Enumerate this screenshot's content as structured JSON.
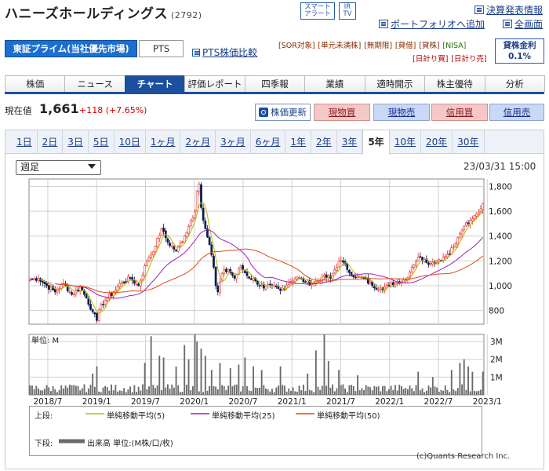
{
  "header": {
    "title": "ハニーズホールディングス",
    "code": "(2792)",
    "smart_alert": [
      "スマート",
      "アラート"
    ],
    "ir_tv": [
      "IR",
      "TV"
    ],
    "portfolio_link": "ポートフォリオへ追加",
    "kessan_link": "決算発表情報",
    "zenshi_link": "全画面",
    "pts_link": "PTS株価比較"
  },
  "market_tabs": [
    "東証プライム(当社優先市場)",
    "PTS"
  ],
  "tags_row1": [
    "[SOR対象]",
    "[単元未満株]",
    "[無期限]",
    "[貸借]",
    "[貸株]",
    "[NISA]"
  ],
  "tags_row2": [
    "[日計り買]",
    "[日計り売]"
  ],
  "rate": {
    "label": "貸株金利",
    "value": "0.1%"
  },
  "nav": [
    "株価",
    "ニュース",
    "チャート",
    "評価レポート",
    "四季報",
    "業績",
    "適時開示",
    "株主優待",
    "分析"
  ],
  "nav_active": 2,
  "price": {
    "label": "現在値",
    "value": "1,661",
    "change": "+118 (+7.65%)"
  },
  "buttons": {
    "update": "株価更新",
    "spot_buy": "現物買",
    "spot_sell": "現物売",
    "margin_buy": "信用買",
    "margin_sell": "信用売"
  },
  "periods": [
    "1日",
    "2日",
    "3日",
    "5日",
    "10日",
    "1ヶ月",
    "2ヶ月",
    "3ヶ月",
    "6ヶ月",
    "1年",
    "2年",
    "3年",
    "5年",
    "10年",
    "20年",
    "30年"
  ],
  "period_active": 12,
  "period_select": "週足",
  "timestamp": "23/03/31 15:00",
  "colors": {
    "up": "#e8302a",
    "down": "#0a1a50",
    "ma5": "#bdb500",
    "ma25": "#a020c0",
    "ma50": "#e04a10",
    "volume": "#6a6a6a",
    "grid": "#d0d0d0"
  },
  "chart_data": {
    "type": "candlestick",
    "x_tick_labels": [
      "2018/7",
      "2019/1",
      "2019/7",
      "2020/1",
      "2020/7",
      "2021/1",
      "2021/7",
      "2022/1",
      "2022/7",
      "2023/1"
    ],
    "price_axis": {
      "ticks": [
        800,
        1000,
        1200,
        1400,
        1600,
        1800
      ],
      "ylim": [
        690,
        1860
      ]
    },
    "price_anchors": [
      [
        0,
        1050
      ],
      [
        4,
        1060
      ],
      [
        8,
        1000
      ],
      [
        12,
        950
      ],
      [
        16,
        1020
      ],
      [
        20,
        930
      ],
      [
        24,
        990
      ],
      [
        27,
        900
      ],
      [
        30,
        790
      ],
      [
        32,
        720
      ],
      [
        34,
        850
      ],
      [
        37,
        900
      ],
      [
        40,
        950
      ],
      [
        44,
        1030
      ],
      [
        48,
        1060
      ],
      [
        52,
        1000
      ],
      [
        56,
        1200
      ],
      [
        60,
        1320
      ],
      [
        63,
        1460
      ],
      [
        66,
        1350
      ],
      [
        70,
        1280
      ],
      [
        74,
        1400
      ],
      [
        77,
        1520
      ],
      [
        79,
        1600
      ],
      [
        80,
        1760
      ],
      [
        81,
        1820
      ],
      [
        82,
        1630
      ],
      [
        84,
        1460
      ],
      [
        86,
        1330
      ],
      [
        88,
        1150
      ],
      [
        89,
        1000
      ],
      [
        90,
        950
      ],
      [
        92,
        1100
      ],
      [
        95,
        1130
      ],
      [
        98,
        1060
      ],
      [
        101,
        1160
      ],
      [
        104,
        1080
      ],
      [
        108,
        1040
      ],
      [
        112,
        980
      ],
      [
        116,
        1000
      ],
      [
        120,
        960
      ],
      [
        124,
        1030
      ],
      [
        128,
        1070
      ],
      [
        132,
        1030
      ],
      [
        136,
        1020
      ],
      [
        140,
        1070
      ],
      [
        144,
        1060
      ],
      [
        148,
        1200
      ],
      [
        150,
        1190
      ],
      [
        152,
        1130
      ],
      [
        156,
        1070
      ],
      [
        160,
        1060
      ],
      [
        164,
        1000
      ],
      [
        168,
        980
      ],
      [
        172,
        1000
      ],
      [
        176,
        1030
      ],
      [
        180,
        1050
      ],
      [
        183,
        1150
      ],
      [
        186,
        1230
      ],
      [
        189,
        1210
      ],
      [
        192,
        1180
      ],
      [
        196,
        1210
      ],
      [
        200,
        1250
      ],
      [
        204,
        1340
      ],
      [
        206,
        1420
      ],
      [
        208,
        1480
      ],
      [
        210,
        1500
      ],
      [
        212,
        1540
      ],
      [
        214,
        1580
      ],
      [
        216,
        1620
      ],
      [
        217,
        1661
      ]
    ],
    "volume_axis": {
      "ticks": [
        "1M",
        "2M",
        "3M"
      ],
      "unit": "単位: M",
      "ylim": [
        0,
        3.4
      ]
    },
    "volume_spikes": [
      [
        30,
        1.2
      ],
      [
        32,
        1.6
      ],
      [
        55,
        1.8
      ],
      [
        58,
        3.3
      ],
      [
        62,
        2.2
      ],
      [
        64,
        2.1
      ],
      [
        70,
        1.6
      ],
      [
        74,
        2.8
      ],
      [
        76,
        2.0
      ],
      [
        79,
        3.4
      ],
      [
        80,
        3.0
      ],
      [
        82,
        2.6
      ],
      [
        84,
        2.2
      ],
      [
        87,
        1.4
      ],
      [
        91,
        1.8
      ],
      [
        96,
        1.5
      ],
      [
        100,
        1.7
      ],
      [
        103,
        2.1
      ],
      [
        107,
        1.6
      ],
      [
        111,
        1.4
      ],
      [
        120,
        1.6
      ],
      [
        133,
        1.2
      ],
      [
        137,
        2.5
      ],
      [
        141,
        3.4
      ],
      [
        143,
        1.9
      ],
      [
        148,
        1.4
      ],
      [
        157,
        1.1
      ],
      [
        186,
        1.3
      ],
      [
        193,
        1.0
      ],
      [
        202,
        1.4
      ],
      [
        206,
        1.8
      ],
      [
        208,
        2.0
      ],
      [
        210,
        1.6
      ],
      [
        212,
        1.3
      ],
      [
        217,
        1.3
      ]
    ],
    "legend": {
      "upper_label": "上段:",
      "lower_label": "下段:",
      "ma5": "単純移動平均(5)",
      "ma25": "単純移動平均(25)",
      "ma50": "単純移動平均(50)",
      "volume": "出来高 単位:(M株/口/枚)"
    }
  },
  "credit": "(c)Quants Research Inc."
}
